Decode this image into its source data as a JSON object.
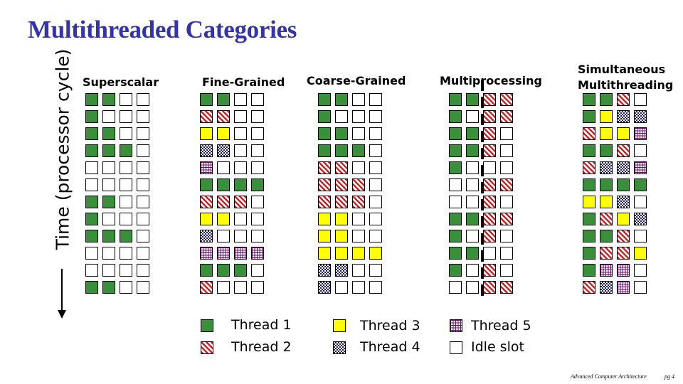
{
  "title": "Multithreaded Categories",
  "time_axis_label": "Time (processor cycle)",
  "legend": [
    {
      "thread": 1,
      "label": "Thread 1",
      "color": "#3a8f3a",
      "pattern": "solid"
    },
    {
      "thread": 2,
      "label": "Thread 2",
      "color": "#c0282c",
      "pattern": "diagonal-stripes"
    },
    {
      "thread": 3,
      "label": "Thread 3",
      "color": "#ffff00",
      "pattern": "solid"
    },
    {
      "thread": 4,
      "label": "Thread 4",
      "color": "#23236a",
      "pattern": "checker"
    },
    {
      "thread": 5,
      "label": "Thread 5",
      "color": "#6a0a6a",
      "pattern": "grid"
    },
    {
      "thread": 0,
      "label": "Idle slot",
      "color": "#ffffff",
      "pattern": "empty"
    }
  ],
  "categories": [
    {
      "name": "Superscalar",
      "grid": [
        [
          1,
          1,
          0,
          0
        ],
        [
          1,
          0,
          0,
          0
        ],
        [
          1,
          1,
          0,
          0
        ],
        [
          1,
          1,
          1,
          0
        ],
        [
          0,
          0,
          0,
          0
        ],
        [
          0,
          0,
          0,
          0
        ],
        [
          1,
          1,
          0,
          0
        ],
        [
          1,
          0,
          0,
          0
        ],
        [
          1,
          1,
          1,
          0
        ],
        [
          0,
          0,
          0,
          0
        ],
        [
          0,
          0,
          0,
          0
        ],
        [
          1,
          1,
          0,
          0
        ]
      ]
    },
    {
      "name": "Fine-Grained",
      "grid": [
        [
          1,
          1,
          0,
          0
        ],
        [
          2,
          2,
          0,
          0
        ],
        [
          3,
          3,
          0,
          0
        ],
        [
          4,
          4,
          0,
          0
        ],
        [
          5,
          0,
          0,
          0
        ],
        [
          1,
          1,
          1,
          1
        ],
        [
          2,
          2,
          2,
          0
        ],
        [
          3,
          3,
          0,
          0
        ],
        [
          4,
          0,
          0,
          0
        ],
        [
          5,
          5,
          5,
          5
        ],
        [
          1,
          1,
          1,
          0
        ],
        [
          2,
          0,
          0,
          0
        ]
      ]
    },
    {
      "name": "Coarse-Grained",
      "grid": [
        [
          1,
          1,
          0,
          0
        ],
        [
          1,
          0,
          0,
          0
        ],
        [
          1,
          1,
          0,
          0
        ],
        [
          1,
          1,
          1,
          0
        ],
        [
          2,
          2,
          0,
          0
        ],
        [
          2,
          2,
          2,
          0
        ],
        [
          2,
          2,
          2,
          0
        ],
        [
          3,
          3,
          0,
          0
        ],
        [
          3,
          3,
          0,
          0
        ],
        [
          3,
          3,
          3,
          3
        ],
        [
          4,
          4,
          0,
          0
        ],
        [
          4,
          0,
          0,
          0
        ]
      ]
    },
    {
      "name": "Multiprocessing",
      "grid": [
        [
          1,
          1,
          2,
          2
        ],
        [
          1,
          0,
          2,
          2
        ],
        [
          1,
          1,
          2,
          0
        ],
        [
          1,
          1,
          2,
          0
        ],
        [
          1,
          0,
          0,
          0
        ],
        [
          0,
          0,
          2,
          2
        ],
        [
          0,
          0,
          2,
          0
        ],
        [
          1,
          1,
          2,
          2
        ],
        [
          1,
          0,
          2,
          0
        ],
        [
          1,
          1,
          0,
          0
        ],
        [
          1,
          0,
          2,
          0
        ],
        [
          0,
          0,
          2,
          2
        ]
      ]
    },
    {
      "name": "Simultaneous Multithreading",
      "name_lines": [
        "Simultaneous",
        "Multithreading"
      ],
      "grid": [
        [
          1,
          1,
          2,
          0
        ],
        [
          1,
          3,
          4,
          4
        ],
        [
          2,
          3,
          3,
          5
        ],
        [
          1,
          1,
          2,
          0
        ],
        [
          2,
          4,
          4,
          5
        ],
        [
          1,
          1,
          1,
          1
        ],
        [
          3,
          3,
          4,
          0
        ],
        [
          1,
          2,
          3,
          4
        ],
        [
          1,
          1,
          2,
          0
        ],
        [
          1,
          2,
          2,
          3
        ],
        [
          1,
          5,
          5,
          0
        ],
        [
          2,
          4,
          5,
          0
        ]
      ]
    }
  ],
  "footer": {
    "course": "Advanced Computer Architecture",
    "page": "pg 4"
  }
}
